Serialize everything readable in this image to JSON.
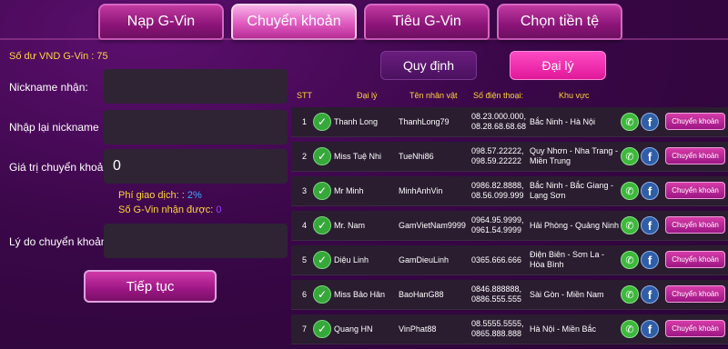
{
  "top_tabs": [
    "Nạp G-Vin",
    "Chuyển khoản",
    "Tiêu G-Vin",
    "Chọn tiền tệ"
  ],
  "left": {
    "balance": "Số dư VND G-Vin : 75",
    "nickname_label": "Nickname nhận:",
    "renickname_label": "Nhập lại nickname",
    "amount_label": "Giá trị chuyển khoản",
    "amount_value": "0",
    "fee_label": "Phí giao dịch: :",
    "fee_value": "2%",
    "receive_label": "Số G-Vin nhận được:",
    "receive_value": "0",
    "reason_label": "Lý do chuyển khoản",
    "continue_label": "Tiếp tục"
  },
  "sub_tabs": {
    "rules": "Quy định",
    "agent": "Đại lý"
  },
  "table": {
    "headers": {
      "stt": "STT",
      "agent": "Đại lý",
      "character": "Tên nhân vật",
      "phone": "Số điện thoại:",
      "area": "Khu vực"
    },
    "transfer_label": "Chuyển khoản",
    "rows": [
      {
        "stt": "1",
        "agent": "Thanh Long",
        "character": "ThanhLong79",
        "phone": "08.23.000.000, 08.28.68.68.68",
        "area": "Bắc Ninh - Hà Nội"
      },
      {
        "stt": "2",
        "agent": "Miss Tuệ Nhi",
        "character": "TueNhi86",
        "phone": "098.57.22222, 098.59.22222",
        "area": "Quy Nhơn - Nha Trang - Miền Trung"
      },
      {
        "stt": "3",
        "agent": "Mr Minh",
        "character": "MinhAnhVin",
        "phone": "0986.82.8888, 08.56.099.999",
        "area": "Bắc Ninh - Bắc Giang - Lạng Sơn"
      },
      {
        "stt": "4",
        "agent": "Mr. Nam",
        "character": "GamVietNam9999",
        "phone": "0964.95.9999, 0961.54.9999",
        "area": "Hải Phòng - Quảng Ninh"
      },
      {
        "stt": "5",
        "agent": "Diệu Linh",
        "character": "GamDieuLinh",
        "phone": "0365.666.666",
        "area": "Điện Biên - Sơn La - Hòa Bình"
      },
      {
        "stt": "6",
        "agent": "Miss Bảo Hân",
        "character": "BaoHanG88",
        "phone": "0846.888888, 0886.555.555",
        "area": "Sài Gòn - Miền Nam"
      },
      {
        "stt": "7",
        "agent": "Quang HN",
        "character": "VinPhat88",
        "phone": "08.5555.5555, 0865.888.888",
        "area": "Hà Nội - Miền Bắc"
      }
    ]
  }
}
